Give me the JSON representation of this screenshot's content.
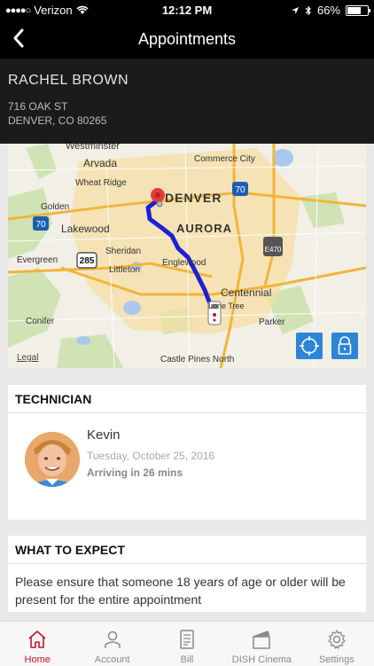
{
  "status_bar": {
    "carrier": "Verizon",
    "time": "12:12 PM",
    "battery": "66%",
    "battery_level": 0.66
  },
  "header": {
    "title": "Appointments"
  },
  "customer": {
    "name": "RACHEL BROWN",
    "address_line1": "716 OAK ST",
    "address_line2": "DENVER, CO 80265"
  },
  "map": {
    "labels": {
      "westminster": "Westminster",
      "commerce_city": "Commerce City",
      "arvada": "Arvada",
      "wheat_ridge": "Wheat Ridge",
      "denver": "DENVER",
      "golden": "Golden",
      "lakewood": "Lakewood",
      "aurora": "AURORA",
      "sheridan": "Sheridan",
      "evergreen": "Evergreen",
      "englewood": "Englewood",
      "littleton": "Littleton",
      "centennial": "Centennial",
      "lone_tree": "Lone Tree",
      "conifer": "Conifer",
      "parker": "Parker",
      "castle_pines_north": "Castle Pines North",
      "legal": "Legal",
      "i70_shield_a": "70",
      "i70_shield_b": "70",
      "us285": "285",
      "e470": "E470"
    }
  },
  "technician": {
    "section_title": "TECHNICIAN",
    "name": "Kevin",
    "date": "Tuesday, October 25, 2016",
    "eta": "Arriving in 26 mins"
  },
  "expect": {
    "section_title": "WHAT TO EXPECT",
    "text": "Please ensure that someone 18 years of age or older will be present for the entire appointment"
  },
  "tabs": [
    {
      "label": "Home",
      "icon": "home-icon",
      "active": true
    },
    {
      "label": "Account",
      "icon": "person-icon",
      "active": false
    },
    {
      "label": "Bill",
      "icon": "bill-icon",
      "active": false
    },
    {
      "label": "DISH Cinema",
      "icon": "clapperboard-icon",
      "active": false
    },
    {
      "label": "Settings",
      "icon": "gear-icon",
      "active": false
    }
  ],
  "colors": {
    "accent": "#c8102e",
    "route": "#1f1fd6",
    "map_button": "#2b86d8",
    "pin": "#e23b3b"
  }
}
